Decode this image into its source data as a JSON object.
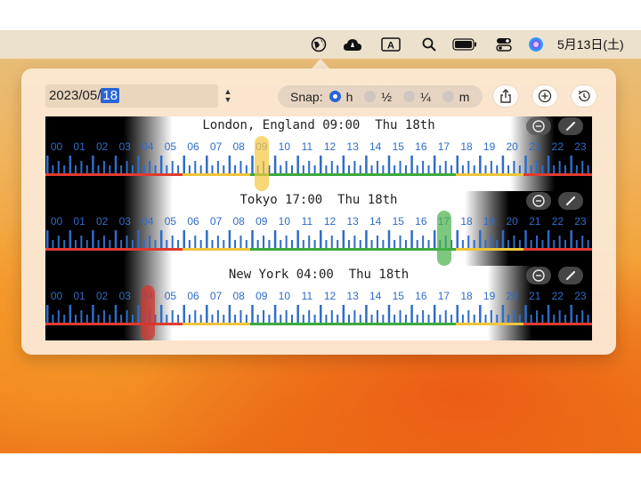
{
  "menubar": {
    "clock": "5月13日(土)",
    "icons": [
      "globe-icon",
      "cloud-icon",
      "input-a-icon",
      "search-icon",
      "battery-icon",
      "control-center-icon",
      "siri-icon"
    ]
  },
  "popover": {
    "date_prefix": "2023/05/",
    "date_day": "18",
    "snap": {
      "label": "Snap:",
      "options": [
        {
          "label": "h",
          "selected": true
        },
        {
          "label": "½",
          "selected": false
        },
        {
          "label": "¼",
          "selected": false
        },
        {
          "label": "m",
          "selected": false
        }
      ]
    },
    "buttons": [
      "share-icon",
      "add-icon",
      "history-icon"
    ]
  },
  "timelines": [
    {
      "title": "London, England 09:00  Thu 18th",
      "marker_hour": 9,
      "marker_color": "#f5c842",
      "dark_until": 5,
      "dark_from": 21,
      "band": [
        {
          "from": 0,
          "to": 6,
          "color": "#e23a2f"
        },
        {
          "from": 6,
          "to": 9,
          "color": "#f0c43a"
        },
        {
          "from": 9,
          "to": 18,
          "color": "#3caa3c"
        },
        {
          "from": 18,
          "to": 21,
          "color": "#f0c43a"
        },
        {
          "from": 21,
          "to": 24,
          "color": "#e23a2f"
        }
      ]
    },
    {
      "title": "Tokyo 17:00  Thu 18th",
      "marker_hour": 17,
      "marker_color": "#4cb24c",
      "dark_until": 5,
      "dark_from": 19,
      "band": [
        {
          "from": 0,
          "to": 6,
          "color": "#e23a2f"
        },
        {
          "from": 6,
          "to": 9,
          "color": "#f0c43a"
        },
        {
          "from": 9,
          "to": 18,
          "color": "#3caa3c"
        },
        {
          "from": 18,
          "to": 21,
          "color": "#f0c43a"
        },
        {
          "from": 21,
          "to": 24,
          "color": "#e23a2f"
        }
      ]
    },
    {
      "title": "New York 04:00  Thu 18th",
      "marker_hour": 4,
      "marker_color": "#d7332a",
      "dark_until": 5,
      "dark_from": 20,
      "band": [
        {
          "from": 0,
          "to": 6,
          "color": "#e23a2f"
        },
        {
          "from": 6,
          "to": 9,
          "color": "#f0c43a"
        },
        {
          "from": 9,
          "to": 18,
          "color": "#3caa3c"
        },
        {
          "from": 18,
          "to": 21,
          "color": "#f0c43a"
        },
        {
          "from": 21,
          "to": 24,
          "color": "#e23a2f"
        }
      ]
    }
  ],
  "hours": [
    "00",
    "01",
    "02",
    "03",
    "04",
    "05",
    "06",
    "07",
    "08",
    "09",
    "10",
    "11",
    "12",
    "13",
    "14",
    "15",
    "16",
    "17",
    "18",
    "19",
    "20",
    "21",
    "22",
    "23"
  ],
  "colors": {
    "accent": "#2a64d6",
    "tick": "#2f6cc8"
  }
}
